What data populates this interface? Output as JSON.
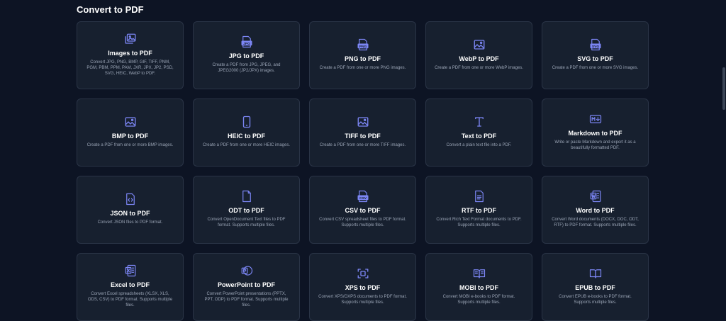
{
  "section": {
    "title": "Convert to PDF"
  },
  "accent": "#7c86f5",
  "cards": [
    {
      "icon": "images-icon",
      "title": "Images to PDF",
      "desc": "Convert JPG, PNG, BMP, GIF, TIFF, PNM, PGM, PBM, PPM, PAM, JXR, JPX, JP2, PSD, SVG, HEIC, WebP to PDF."
    },
    {
      "icon": "jpg-file-icon",
      "title": "JPG to PDF",
      "desc": "Create a PDF from JPG, JPEG, and JPEG2000 (JP2/JPX) images."
    },
    {
      "icon": "png-file-icon",
      "title": "PNG to PDF",
      "desc": "Create a PDF from one or more PNG images."
    },
    {
      "icon": "image-icon",
      "title": "WebP to PDF",
      "desc": "Create a PDF from one or more WebP images."
    },
    {
      "icon": "svg-file-icon",
      "title": "SVG to PDF",
      "desc": "Create a PDF from one or more SVG images."
    },
    {
      "icon": "image-icon",
      "title": "BMP to PDF",
      "desc": "Create a PDF from one or more BMP images."
    },
    {
      "icon": "phone-icon",
      "title": "HEIC to PDF",
      "desc": "Create a PDF from one or more HEIC images."
    },
    {
      "icon": "image-icon",
      "title": "TIFF to PDF",
      "desc": "Create a PDF from one or more TIFF images."
    },
    {
      "icon": "text-icon",
      "title": "Text to PDF",
      "desc": "Convert a plain text file into a PDF."
    },
    {
      "icon": "markdown-icon",
      "title": "Markdown to PDF",
      "desc": "Write or paste Markdown and export it as a beautifully formatted PDF."
    },
    {
      "icon": "json-file-icon",
      "title": "JSON to PDF",
      "desc": "Convert JSON files to PDF format."
    },
    {
      "icon": "file-icon",
      "title": "ODT to PDF",
      "desc": "Convert OpenDocument Text files to PDF format. Supports multiple files."
    },
    {
      "icon": "csv-file-icon",
      "title": "CSV to PDF",
      "desc": "Convert CSV spreadsheet files to PDF format. Supports multiple files."
    },
    {
      "icon": "document-text-icon",
      "title": "RTF to PDF",
      "desc": "Convert Rich Text Format documents to PDF. Supports multiple files."
    },
    {
      "icon": "word-icon",
      "title": "Word to PDF",
      "desc": "Convert Word documents (DOCX, DOC, ODT, RTF) to PDF format. Supports multiple files."
    },
    {
      "icon": "excel-icon",
      "title": "Excel to PDF",
      "desc": "Convert Excel spreadsheets (XLSX, XLS, ODS, CSV) to PDF format. Supports multiple files."
    },
    {
      "icon": "powerpoint-icon",
      "title": "PowerPoint to PDF",
      "desc": "Convert PowerPoint presentations (PPTX, PPT, ODP) to PDF format. Supports multiple files."
    },
    {
      "icon": "scan-frame-icon",
      "title": "XPS to PDF",
      "desc": "Convert XPS/OXPS documents to PDF format. Supports multiple files."
    },
    {
      "icon": "book-open-icon",
      "title": "MOBI to PDF",
      "desc": "Convert MOBI e-books to PDF format. Supports multiple files."
    },
    {
      "icon": "book-icon",
      "title": "EPUB to PDF",
      "desc": "Convert EPUB e-books to PDF format. Supports multiple files."
    }
  ],
  "icon_labels": {
    "jpg": "JPG",
    "png": "PNG",
    "svg": "SVG",
    "csv": "CSV"
  }
}
